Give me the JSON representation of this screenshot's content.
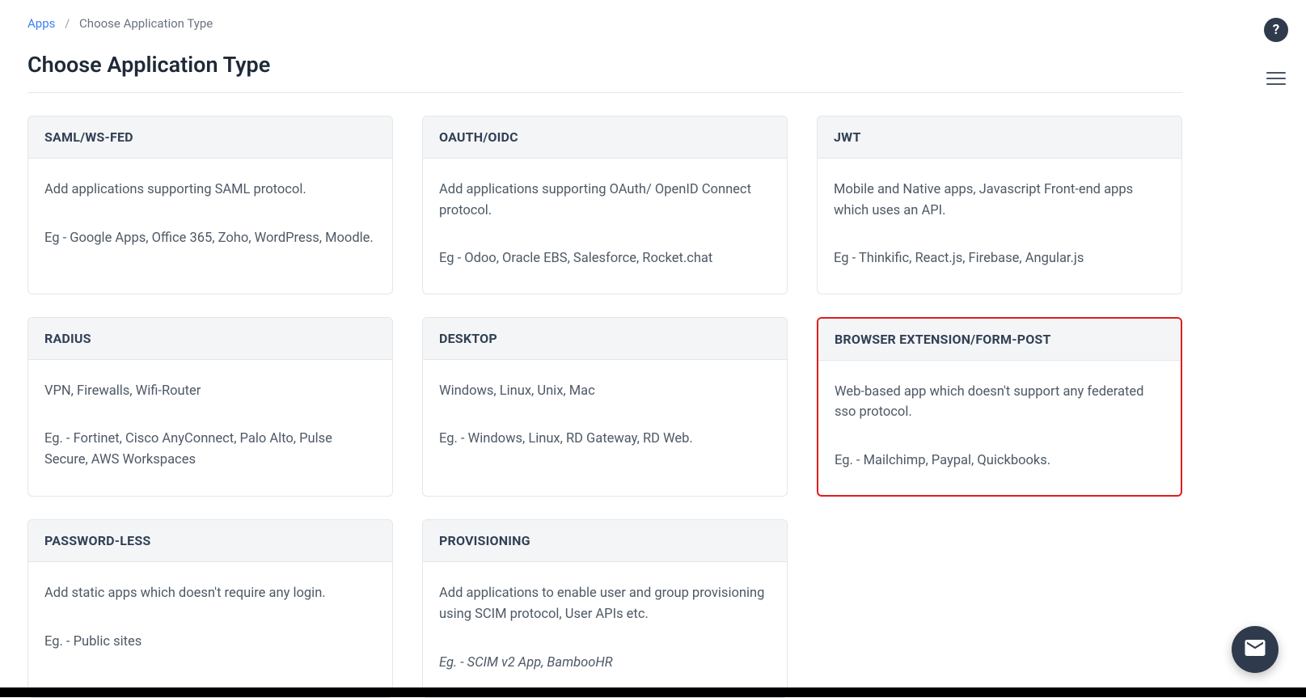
{
  "breadcrumb": {
    "root": "Apps",
    "current": "Choose Application Type"
  },
  "page_title": "Choose Application Type",
  "cards": [
    {
      "key": "saml",
      "title": "SAML/WS-FED",
      "desc": "Add applications supporting SAML protocol.",
      "eg": "Eg - Google Apps, Office 365, Zoho, WordPress, Moodle.",
      "highlight": false
    },
    {
      "key": "oauth",
      "title": "OAUTH/OIDC",
      "desc": "Add applications supporting OAuth/ OpenID Connect protocol.",
      "eg": "Eg - Odoo, Oracle EBS, Salesforce, Rocket.chat",
      "highlight": false
    },
    {
      "key": "jwt",
      "title": "JWT",
      "desc": "Mobile and Native apps, Javascript Front-end apps which uses an API.",
      "eg": "Eg - Thinkific, React.js, Firebase, Angular.js",
      "highlight": false
    },
    {
      "key": "radius",
      "title": "RADIUS",
      "desc": "VPN, Firewalls, Wifi-Router",
      "eg": "Eg. - Fortinet, Cisco AnyConnect, Palo Alto, Pulse Secure, AWS Workspaces",
      "highlight": false
    },
    {
      "key": "desktop",
      "title": "DESKTOP",
      "desc": "Windows, Linux, Unix, Mac",
      "eg": "Eg. - Windows, Linux, RD Gateway, RD Web.",
      "highlight": false
    },
    {
      "key": "browser-ext",
      "title": "BROWSER EXTENSION/FORM-POST",
      "desc": "Web-based app which doesn't support any federated sso protocol.",
      "eg": "Eg. - Mailchimp, Paypal, Quickbooks.",
      "highlight": true
    },
    {
      "key": "password-less",
      "title": "PASSWORD-LESS",
      "desc": "Add static apps which doesn't require any login.",
      "eg": "Eg. - Public sites",
      "highlight": false
    },
    {
      "key": "provisioning",
      "title": "PROVISIONING",
      "desc": "Add applications to enable user and group provisioning using SCIM protocol, User APIs etc.",
      "eg": "Eg. - SCIM v2 App, BambooHR",
      "eg_italic": true,
      "highlight": false
    }
  ],
  "icons": {
    "help": "?",
    "menu": "menu-icon",
    "chat": "mail-icon"
  }
}
